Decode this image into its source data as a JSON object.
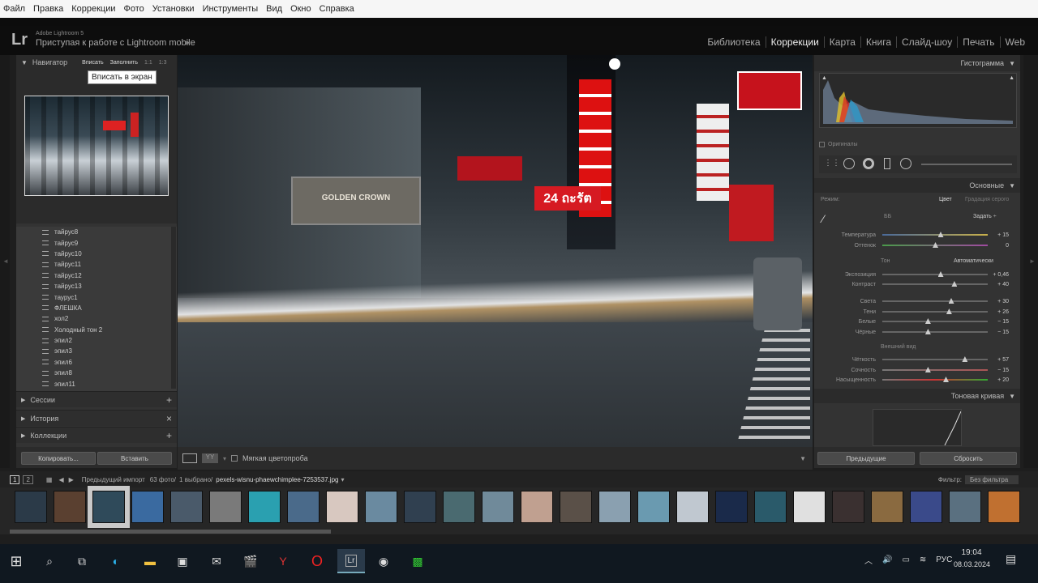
{
  "menubar": [
    "Файл",
    "Правка",
    "Коррекции",
    "Фото",
    "Установки",
    "Инструменты",
    "Вид",
    "Окно",
    "Справка"
  ],
  "identity": {
    "logo": "Lr",
    "product": "Adobe Lightroom 5",
    "subtitle": "Приступая к работе с Lightroom mobile"
  },
  "modules": [
    "Библиотека",
    "Коррекции",
    "Карта",
    "Книга",
    "Слайд-шоу",
    "Печать",
    "Web"
  ],
  "active_module": "Коррекции",
  "navigator": {
    "title": "Навигатор",
    "fit": "Вписать",
    "fill": "Заполнить",
    "one": "1:1",
    "ratio": "1:3",
    "tooltip": "Вписать в экран"
  },
  "presets": [
    "тайрус8",
    "тайрус9",
    "тайрус10",
    "тайрус11",
    "тайрус12",
    "тайрус13",
    "таурус1",
    "ФЛЕШКА",
    "хол2",
    "Холодный тон 2",
    "эпил2",
    "эпил3",
    "эпил6",
    "эпил8",
    "эпил11"
  ],
  "sections": {
    "sessions": "Сессии",
    "history": "История",
    "collections": "Коллекции"
  },
  "left_buttons": {
    "copy": "Копировать...",
    "paste": "Вставить"
  },
  "toolbar": {
    "soft_proof": "Мягкая цветопроба"
  },
  "right": {
    "histogram": "Гистограмма",
    "originals": "Оригиналы",
    "basic": "Основные",
    "mode": "Режим:",
    "color": "Цвет",
    "grayscale": "Градация серого",
    "wb_label": "ББ",
    "wb_value": "Задать ÷",
    "tone": "Тон",
    "auto": "Автоматически",
    "presence": "Внешний вид",
    "tone_curve": "Тоновая кривая",
    "previous": "Предыдущие",
    "reset": "Сбросить"
  },
  "sliders": [
    {
      "label": "Температура",
      "value": "+ 15",
      "pos": 0.55
    },
    {
      "label": "Оттенок",
      "value": "0",
      "pos": 0.5
    },
    {
      "label": "Экспозиция",
      "value": "+ 0,46",
      "pos": 0.55
    },
    {
      "label": "Контраст",
      "value": "+ 40",
      "pos": 0.68
    },
    {
      "label": "Света",
      "value": "+ 30",
      "pos": 0.65
    },
    {
      "label": "Тени",
      "value": "+ 26",
      "pos": 0.63
    },
    {
      "label": "Белые",
      "value": "− 15",
      "pos": 0.43
    },
    {
      "label": "Чёрные",
      "value": "− 15",
      "pos": 0.43
    },
    {
      "label": "Чёткость",
      "value": "+ 57",
      "pos": 0.78
    },
    {
      "label": "Сочность",
      "value": "− 15",
      "pos": 0.43
    },
    {
      "label": "Насыщенность",
      "value": "+ 20",
      "pos": 0.6
    }
  ],
  "filmstrip": {
    "page1": "1",
    "page2": "2",
    "source": "Предыдущий импорт",
    "count": "63 фото/",
    "selected": "1 выбрано/",
    "filename": "pexels-wisnu-phaewchimplee-7253537.jpg",
    "filter_label": "Фильтр:",
    "filter_value": "Без фильтра"
  },
  "photo_signs": {
    "sign1": "24 ถะรัต",
    "sign2": "GOLDEN CROWN"
  },
  "taskbar": {
    "lang": "РУС",
    "time": "19:04",
    "date": "08.03.2024"
  }
}
